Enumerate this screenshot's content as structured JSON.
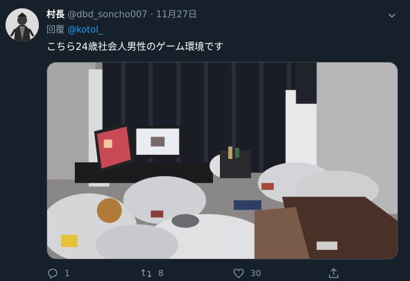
{
  "tweet": {
    "display_name": "村長",
    "handle": "@dbd_soncho007",
    "separator": "·",
    "date": "11月27日",
    "reply_prefix": "回覆",
    "reply_to": "@kotol_",
    "text": "こちら24歳社会人男性のゲーム環境です"
  },
  "actions": {
    "reply_count": "1",
    "retweet_count": "8",
    "like_count": "30"
  },
  "icons": {
    "more": "chevron-down-icon",
    "reply": "comment-icon",
    "retweet": "retweet-icon",
    "like": "heart-icon",
    "share": "share-icon"
  },
  "colors": {
    "background": "#15202b",
    "secondary_text": "#8899a6",
    "link": "#1da1f2"
  }
}
